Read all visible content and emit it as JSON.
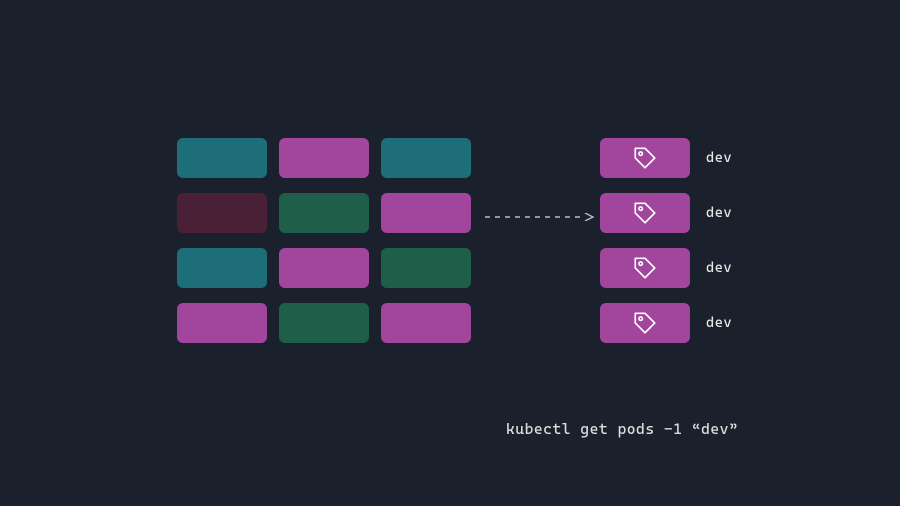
{
  "colors": {
    "background": "#1b212c",
    "teal": "#1e6e7a",
    "magenta": "#a2459c",
    "maroon": "#4a2036",
    "green": "#1f5f4a",
    "text": "#e6e6e6",
    "icon_stroke": "#ffffff"
  },
  "grid": {
    "rows": 4,
    "cols": 3,
    "cells": [
      [
        "teal",
        "magenta",
        "teal"
      ],
      [
        "maroon",
        "green",
        "magenta"
      ],
      [
        "teal",
        "magenta",
        "green"
      ],
      [
        "magenta",
        "green",
        "magenta"
      ]
    ]
  },
  "arrow": {
    "style": "dashed",
    "direction": "right"
  },
  "tagged": [
    {
      "label": "dev",
      "icon": "tag-icon"
    },
    {
      "label": "dev",
      "icon": "tag-icon"
    },
    {
      "label": "dev",
      "icon": "tag-icon"
    },
    {
      "label": "dev",
      "icon": "tag-icon"
    }
  ],
  "command": "kubectl get pods -1 “dev”"
}
